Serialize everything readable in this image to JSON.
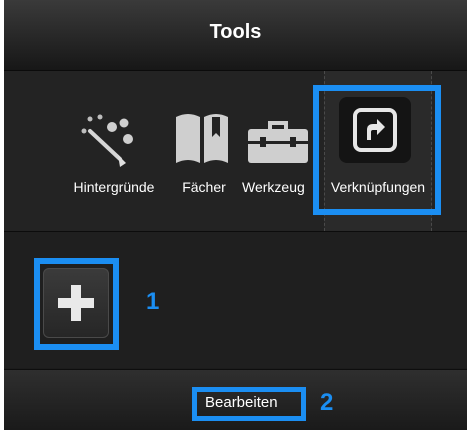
{
  "header": {
    "title": "Tools"
  },
  "tabs": [
    {
      "label": "Hintergründe",
      "icon": "paint-brush-icon"
    },
    {
      "label": "Fächer",
      "icon": "book-icon"
    },
    {
      "label": "Werkzeug",
      "icon": "toolbox-icon"
    },
    {
      "label": "Verknüpfungen",
      "icon": "shortcut-arrow-icon",
      "selected": true
    }
  ],
  "content": {
    "add_icon": "plus-icon"
  },
  "footer": {
    "edit_label": "Bearbeiten"
  },
  "annotations": [
    {
      "label": "1",
      "target": "add-button"
    },
    {
      "label": "2",
      "target": "edit-button"
    }
  ],
  "colors": {
    "highlight": "#1b8ef2",
    "panel": "#1c1c1c",
    "text": "#ffffff"
  }
}
